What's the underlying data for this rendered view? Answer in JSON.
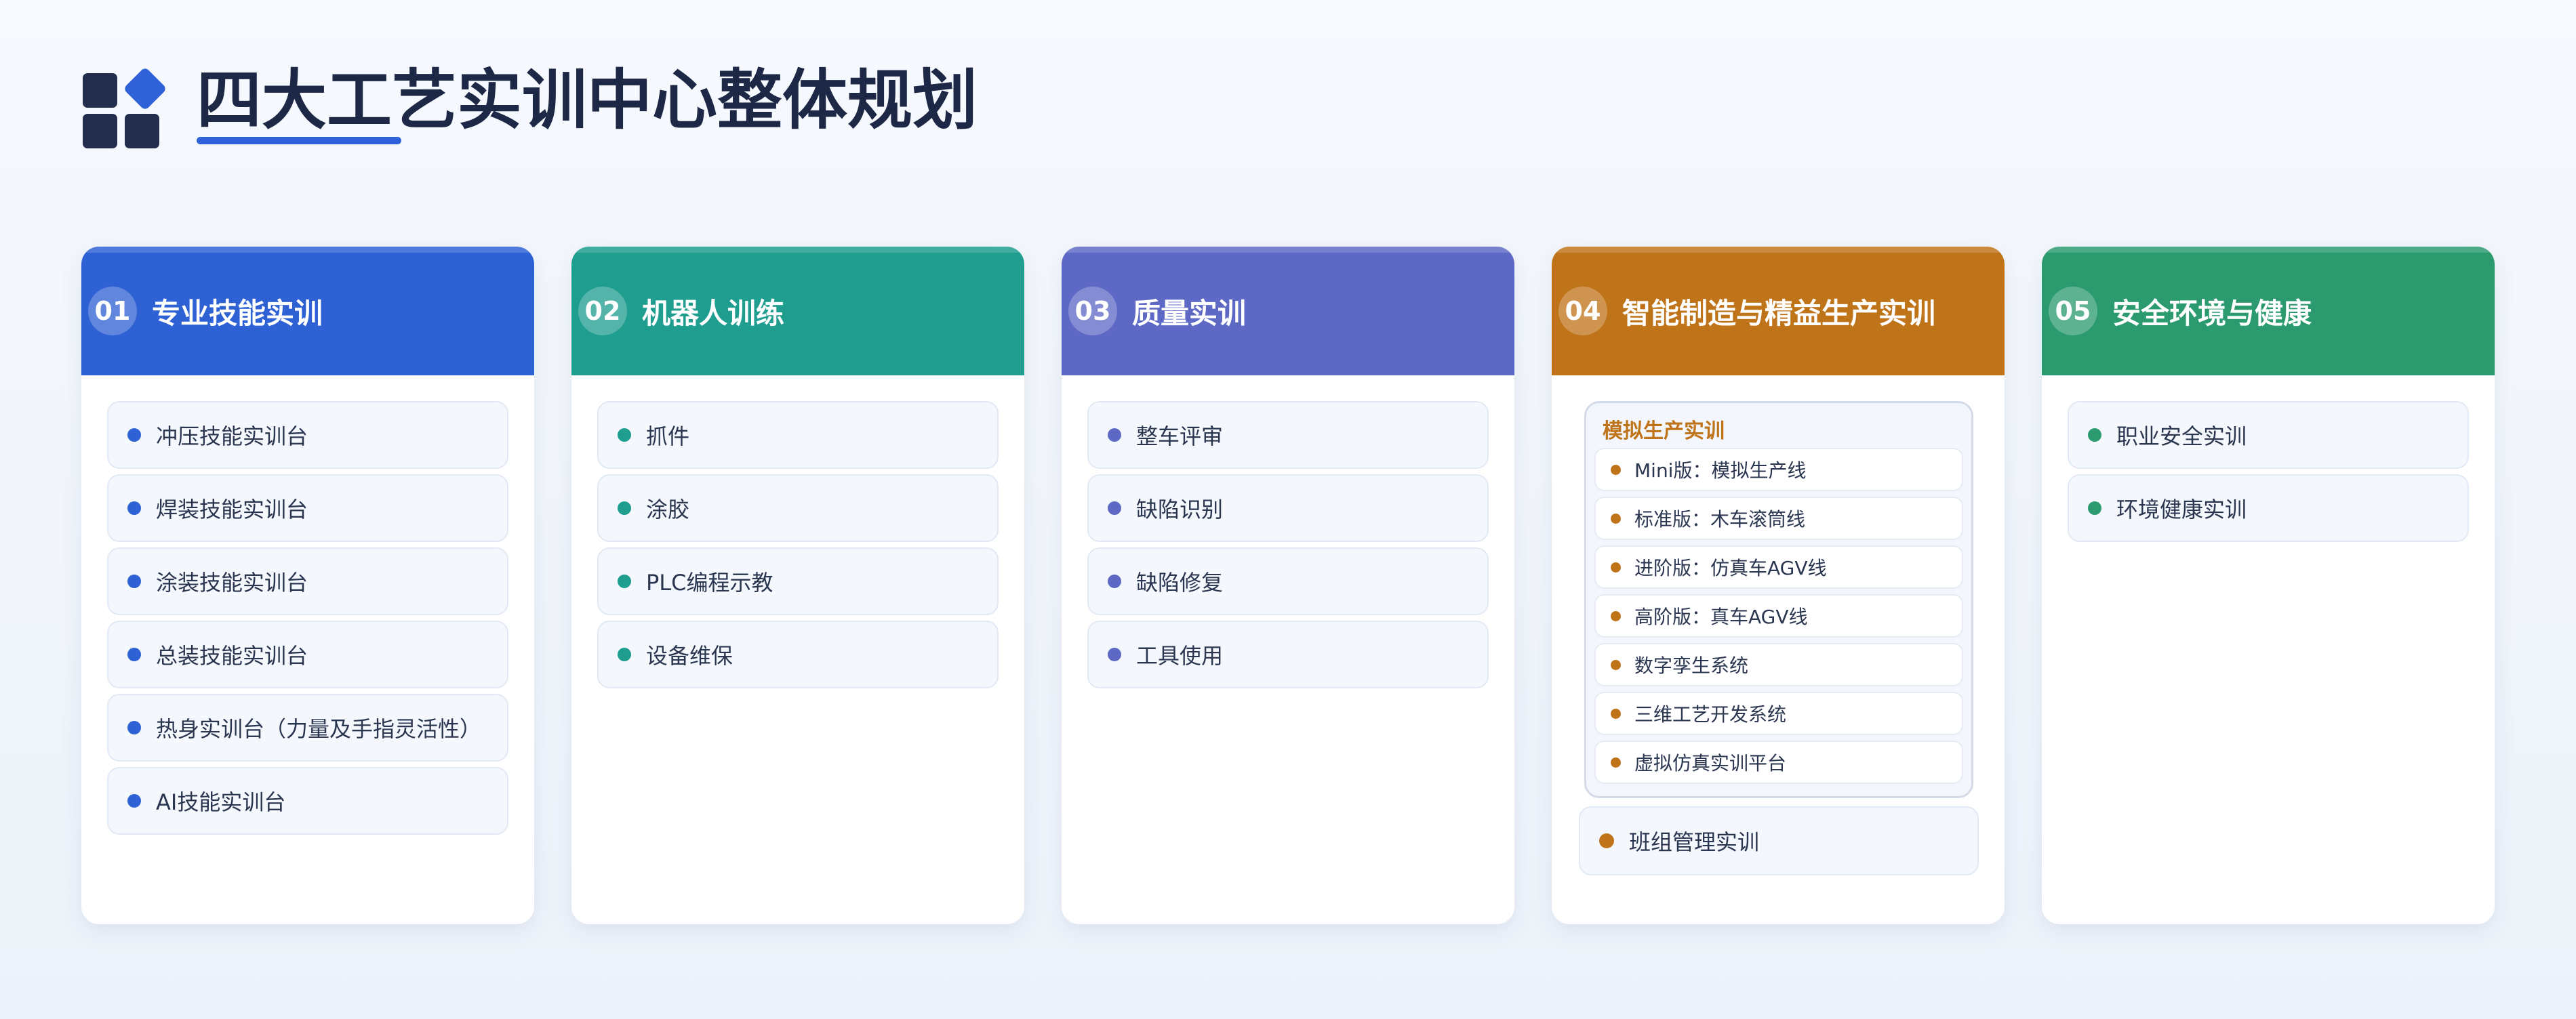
{
  "page": {
    "title": "四大工艺实训中心整体规划"
  },
  "colors": {
    "title": "#1d2846",
    "accent": "#2f62d8"
  },
  "cards": [
    {
      "number": "01",
      "title": "专业技能实训",
      "color": "#2e61d4",
      "dot_color": "#2e61d4",
      "items": [
        "冲压技能实训台",
        "焊装技能实训台",
        "涂装技能实训台",
        "总装技能实训台",
        "热身实训台（力量及手指灵活性）",
        "AI技能实训台"
      ]
    },
    {
      "number": "02",
      "title": "机器人训练",
      "color": "#1f9d8f",
      "dot_color": "#1f9d8f",
      "items": [
        "抓件",
        "涂胶",
        "PLC编程示教",
        "设备维保"
      ]
    },
    {
      "number": "03",
      "title": "质量实训",
      "color": "#5e69c5",
      "dot_color": "#5e69c5",
      "items": [
        "整车评审",
        "缺陷识别",
        "缺陷修复",
        "工具使用"
      ]
    },
    {
      "number": "04",
      "title": "智能制造与精益生产实训",
      "color": "#c0741a",
      "dot_color": "#c0741a",
      "subgroup": {
        "title": "模拟生产实训",
        "items": [
          "Mini版：模拟生产线",
          "标准版：木车滚筒线",
          "进阶版：仿真车AGV线",
          "高阶版：真车AGV线",
          "数字孪生系统",
          "三维工艺开发系统",
          "虚拟仿真实训平台"
        ]
      },
      "items": [
        "班组管理实训"
      ]
    },
    {
      "number": "05",
      "title": "安全环境与健康",
      "color": "#2b9a6f",
      "dot_color": "#2b9a6f",
      "items": [
        "职业安全实训",
        "环境健康实训"
      ]
    }
  ]
}
